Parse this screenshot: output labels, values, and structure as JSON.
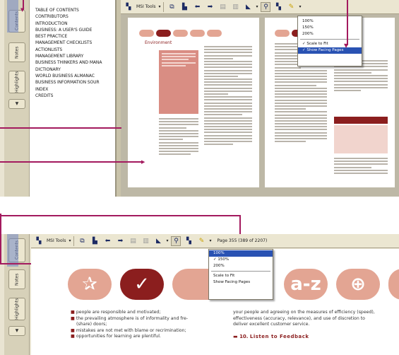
{
  "toc": {
    "items": [
      {
        "label": "TABLE OF CONTENTS",
        "highlighted": false
      },
      {
        "label": "CONTRIBUTORS",
        "highlighted": false
      },
      {
        "label": "INTRODUCTION",
        "highlighted": false
      },
      {
        "label": "BUSINESS: A USER'S GUIDE",
        "highlighted": false
      },
      {
        "label": "BEST PRACTICE",
        "highlighted": false
      },
      {
        "label": "MANAGEMENT CHECKLISTS",
        "highlighted": true
      },
      {
        "label": "ACTIONLISTS",
        "highlighted": false
      },
      {
        "label": "MANAGEMENT LIBRARY",
        "highlighted": false
      },
      {
        "label": "BUSINESS THINKERS AND MANA",
        "highlighted": false
      },
      {
        "label": "DICTIONARY",
        "highlighted": false
      },
      {
        "label": "WORLD BUSINESS ALMANAC",
        "highlighted": false
      },
      {
        "label": "BUSINESS INFORMATION SOUR",
        "highlighted": false
      },
      {
        "label": "INDEX",
        "highlighted": false
      },
      {
        "label": "CREDITS",
        "highlighted": false
      }
    ]
  },
  "side_tabs": [
    "Contents",
    "Notes",
    "Highlights"
  ],
  "toolbar": {
    "tools_label": "MSI Tools",
    "page_readout": "Page 355 (389 of 2207)"
  },
  "zoom_menu_top": {
    "items": [
      {
        "label": "100%",
        "checked": false,
        "selected": false
      },
      {
        "label": "150%",
        "checked": false,
        "selected": false
      },
      {
        "label": "200%",
        "checked": false,
        "selected": false
      },
      {
        "label": "Scale to Fit",
        "checked": true,
        "selected": false
      },
      {
        "label": "Show Facing Pages",
        "checked": true,
        "selected": true
      }
    ]
  },
  "zoom_menu_bottom": {
    "items": [
      {
        "label": "100%",
        "checked": false,
        "selected": true
      },
      {
        "label": "150%",
        "checked": true,
        "selected": false
      },
      {
        "label": "200%",
        "checked": false,
        "selected": false
      },
      {
        "label": "Scale to Fit",
        "checked": false,
        "selected": false
      },
      {
        "label": "Show Facing Pages",
        "checked": false,
        "selected": false
      }
    ]
  },
  "document": {
    "left_page_heading": "Environment",
    "bullets": [
      "people are responsible and motivated;",
      "the prevailing atmosphere is of informality and fre-",
      "(share) doors;",
      "mistakes are not met with blame or recrimination;",
      "opportunities for learning are plentiful."
    ],
    "right_text": "your people and agreeing on the measures of efficiency (speed), effectiveness (accuracy, relevance), and use of discretion to deliver excellent customer service.",
    "section_number": "10.",
    "section_title": "Listen to Feedback",
    "big_pill_text": "a-z"
  },
  "colors": {
    "accent": "#8b1e1e",
    "pill": "#e3a593",
    "selection": "#2952b3",
    "callout": "#a31a5e"
  }
}
